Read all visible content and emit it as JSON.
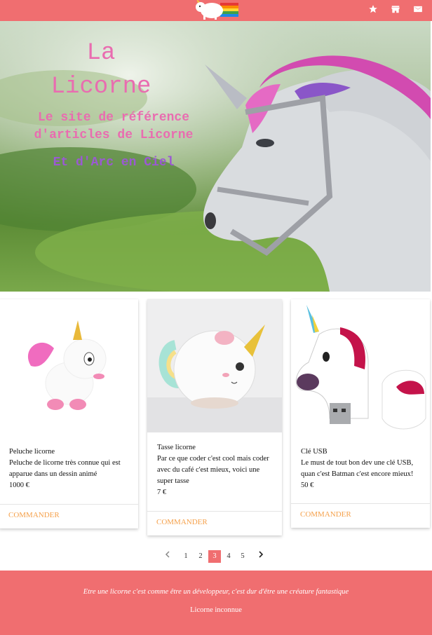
{
  "hero": {
    "title": "La\nLicorne",
    "subtitle": "Le site de référence d'articles de Licorne",
    "tagline": "Et d'Arc en Ciel"
  },
  "nav": {
    "icons": [
      "star-icon",
      "store-icon",
      "mail-icon"
    ]
  },
  "products": [
    {
      "name": "Peluche licorne",
      "description": "Peluche de licorne très connue qui est apparue dans un dessin animé",
      "price": "1000 €",
      "action": "COMMANDER"
    },
    {
      "name": "Tasse licorne",
      "description": "Par ce que coder c'est cool mais coder avec du café c'est mieux, voici une super tasse",
      "price": "7 €",
      "action": "COMMANDER"
    },
    {
      "name": "Clé USB",
      "description": "Le must de tout bon dev une clé USB, quan c'est Batman c'est encore mieux!",
      "price": "50 €",
      "action": "COMMANDER"
    }
  ],
  "pagination": {
    "pages": [
      "1",
      "2",
      "3",
      "4",
      "5"
    ],
    "current": "3",
    "prev": "‹",
    "next": "›"
  },
  "footer": {
    "quote": "Etre une licorne c'est comme être un développeur, c'est dur d'être une créature fantastique",
    "author": "Licorne inconnue"
  },
  "colors": {
    "brand": "#f06e70",
    "action": "#f5a04a",
    "hero_pink": "#e96cb0",
    "hero_purple": "#9b59d3"
  }
}
